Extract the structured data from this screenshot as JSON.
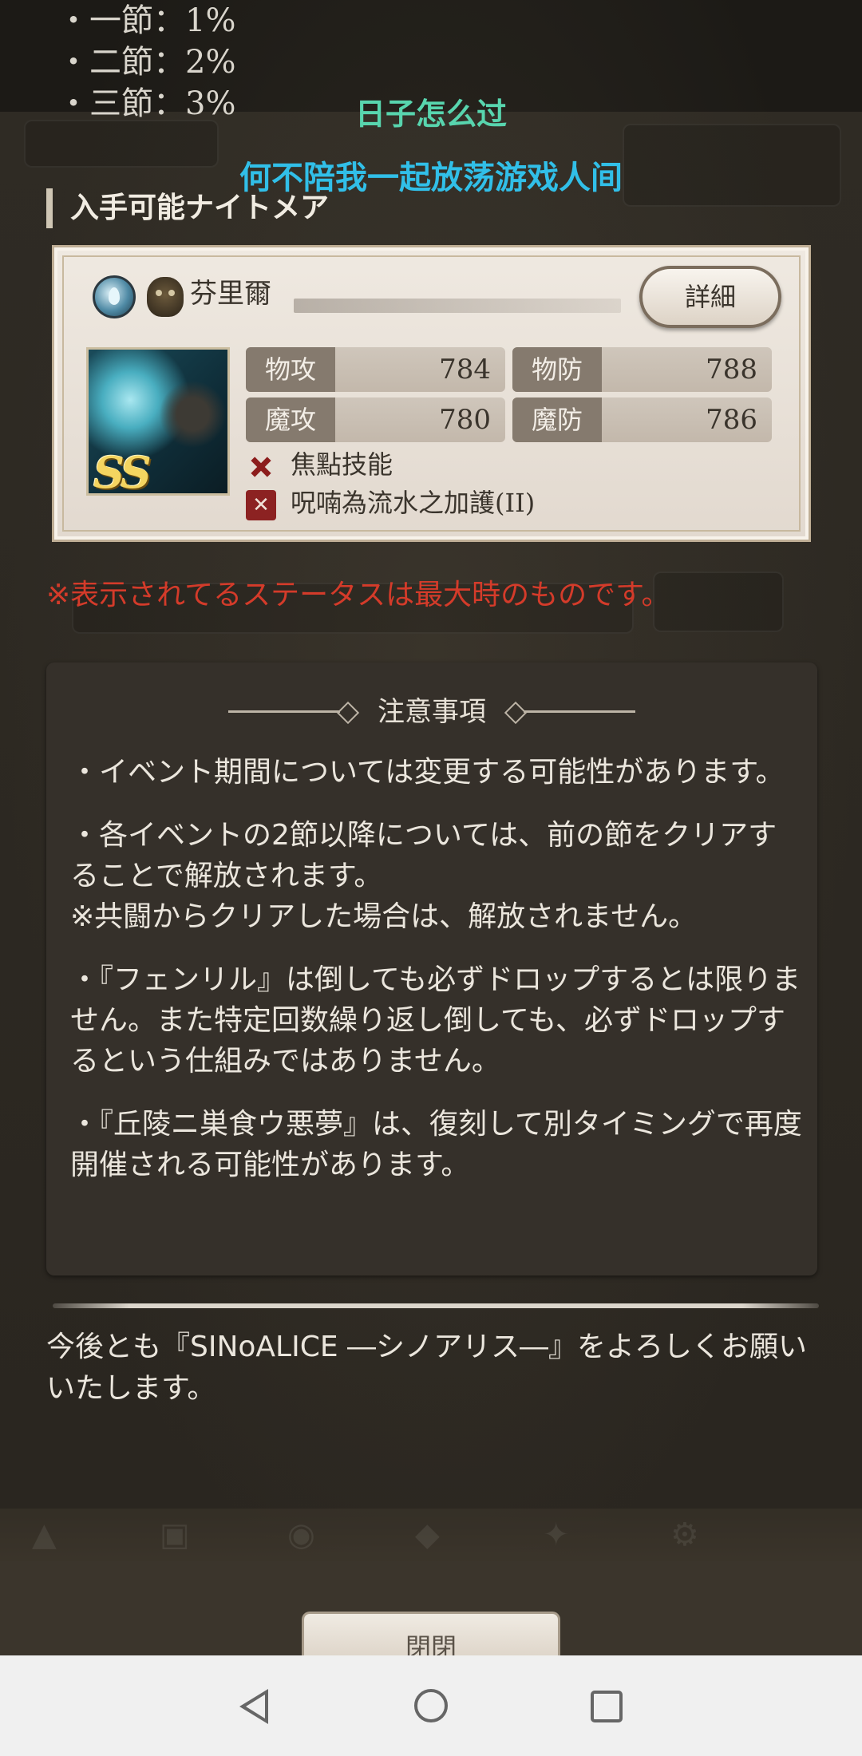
{
  "top_list": [
    "・一節：1%",
    "・二節：2%",
    "・三節：3%"
  ],
  "overlay": {
    "line1": "日子怎么过",
    "line2": "何不陪我一起放荡游戏人间"
  },
  "section_title": "入手可能ナイトメア",
  "card": {
    "name": "芬里爾",
    "detail_button": "詳細",
    "rank": "SS",
    "stats": [
      {
        "label": "物攻",
        "value": "784"
      },
      {
        "label": "物防",
        "value": "788"
      },
      {
        "label": "魔攻",
        "value": "780"
      },
      {
        "label": "魔防",
        "value": "786"
      }
    ],
    "skill_focus": "焦點技能",
    "skill_name": "呪喃為流水之加護(II)"
  },
  "status_note": "※表示されてるステータスは最大時のものです。",
  "notice": {
    "title": "注意事項",
    "p1": "・イベント期間については変更する可能性があります。",
    "p2a": "・各イベントの2節以降については、前の節をクリアすることで解放されます。",
    "p2b": "※共闘からクリアした場合は、解放されません。",
    "p3": "・『フェンリル』は倒しても必ずドロップするとは限りません。また特定回数繰り返し倒しても、必ずドロップするという仕組みではありません。",
    "p4": "・『丘陵ニ巣食ウ悪夢』は、復刻して別タイミングで再度開催される可能性があります。"
  },
  "closing": "今後とも『SINoALICE ―シノアリス―』をよろしくお願いいたします。",
  "close_button": "閉閉",
  "colors": {
    "overlay_green": "#58d5ae",
    "overlay_blue": "#31bfe8",
    "warning_red": "#d43b2a"
  },
  "icons": {
    "element": "water-drop-icon",
    "class": "mask-icon",
    "focus": "focus-cross-icon",
    "skill": "skill-icon"
  }
}
